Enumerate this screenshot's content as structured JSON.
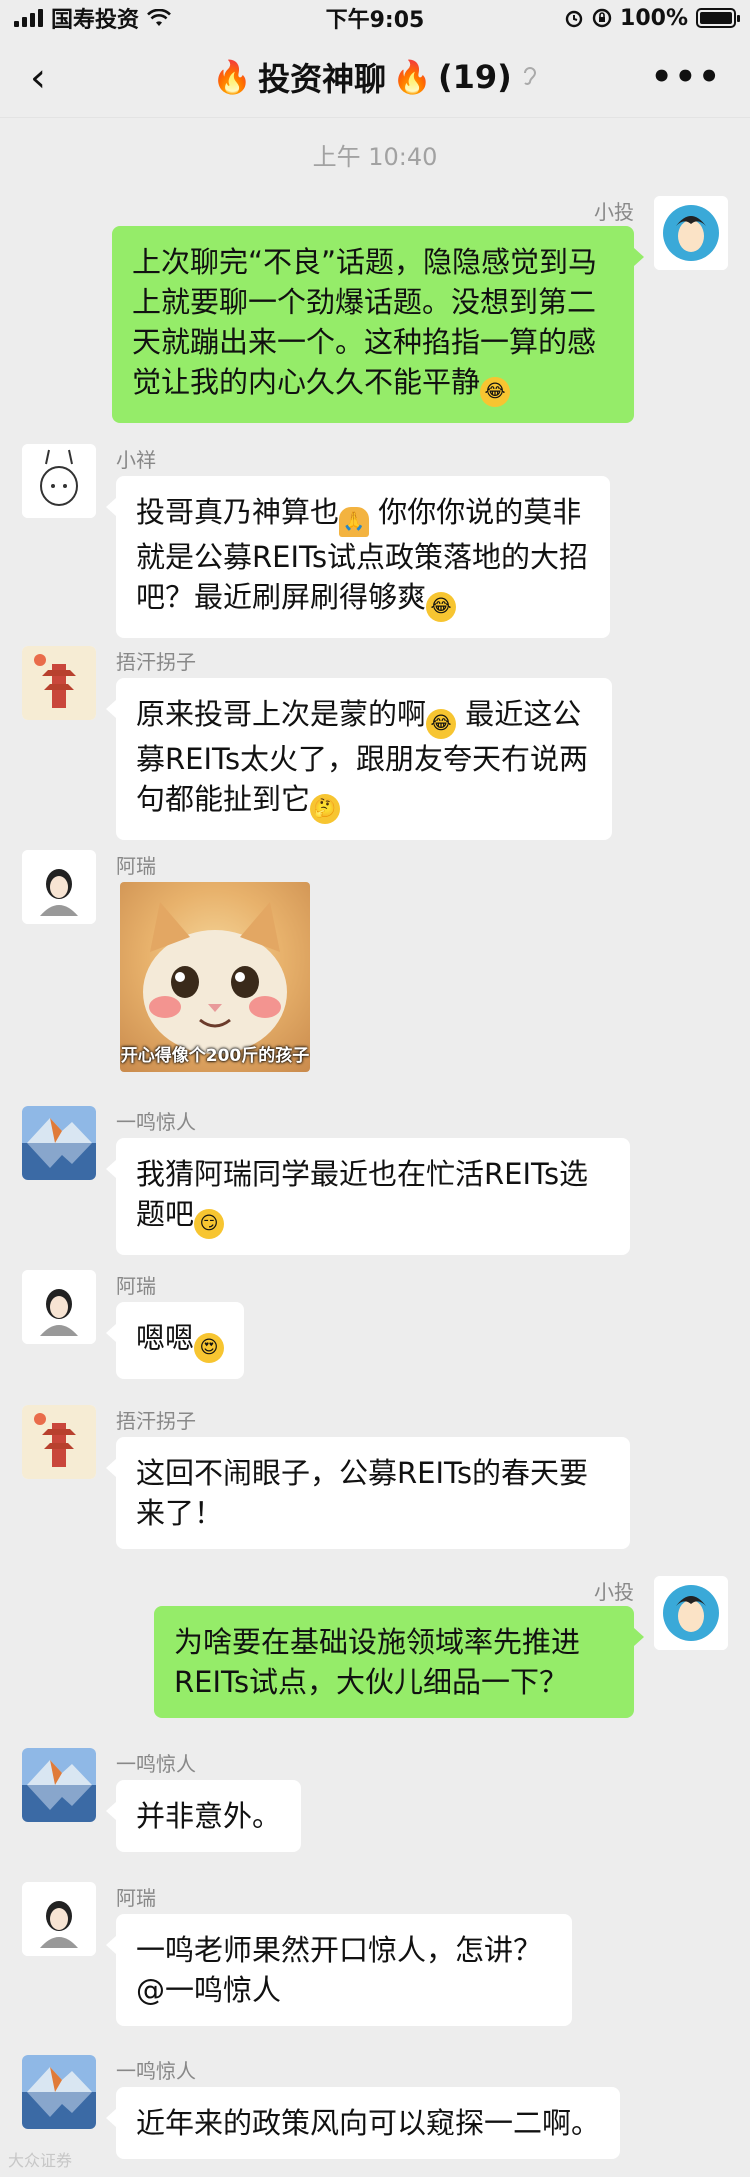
{
  "status": {
    "carrier": "国寿投资",
    "time": "下午9:05",
    "battery": "100%",
    "battery_level": 1.0
  },
  "nav": {
    "back": "‹",
    "fire": "🔥",
    "title": "投资神聊",
    "count": "(19)",
    "more": "•••"
  },
  "time_divider": "上午 10:40",
  "messages": [
    {
      "sender": "小投",
      "side": "right",
      "text": "上次聊完“不良”话题，隐隐感觉到马上就要聊一个劲爆话题。没想到第二天就蹦出来一个。这种掐指一算的感觉让我的内心久久不能平静"
    },
    {
      "sender": "小祥",
      "side": "left",
      "text_a": "投哥真乃神算也",
      "text_b": "你你你说的莫非就是公募REITs试点政策落地的大招吧？最近刷屏刷得够爽"
    },
    {
      "sender": "捂汗拐子",
      "side": "left",
      "text_a": "原来投哥上次是蒙的啊",
      "text_b": "最近这公募REITs太火了，跟朋友夸天冇说两句都能扯到它"
    },
    {
      "sender": "阿瑞",
      "side": "left",
      "sticker_caption": "开心得像个200斤的孩子"
    },
    {
      "sender": "一鸣惊人",
      "side": "left",
      "text": "我猜阿瑞同学最近也在忙活REITs选题吧"
    },
    {
      "sender": "阿瑞",
      "side": "left",
      "text": "嗯嗯"
    },
    {
      "sender": "捂汗拐子",
      "side": "left",
      "text": "这回不闹眼子，公募REITs的春天要来了！"
    },
    {
      "sender": "小投",
      "side": "right",
      "text": "为啥要在基础设施领域率先推进REITs试点，大伙儿细品一下？"
    },
    {
      "sender": "一鸣惊人",
      "side": "left",
      "text": "并非意外。"
    },
    {
      "sender": "阿瑞",
      "side": "left",
      "text": "一鸣老师果然开口惊人，怎讲？@一鸣惊人"
    },
    {
      "sender": "一鸣惊人",
      "side": "left",
      "text": "近年来的政策风向可以窥探一二啊。"
    }
  ],
  "watermark": "大众证券",
  "icons": {
    "wifi": "wifi-icon",
    "alarm": "alarm-icon",
    "lock_rotation": "rotation-lock-icon",
    "ear": "ear-icon"
  }
}
